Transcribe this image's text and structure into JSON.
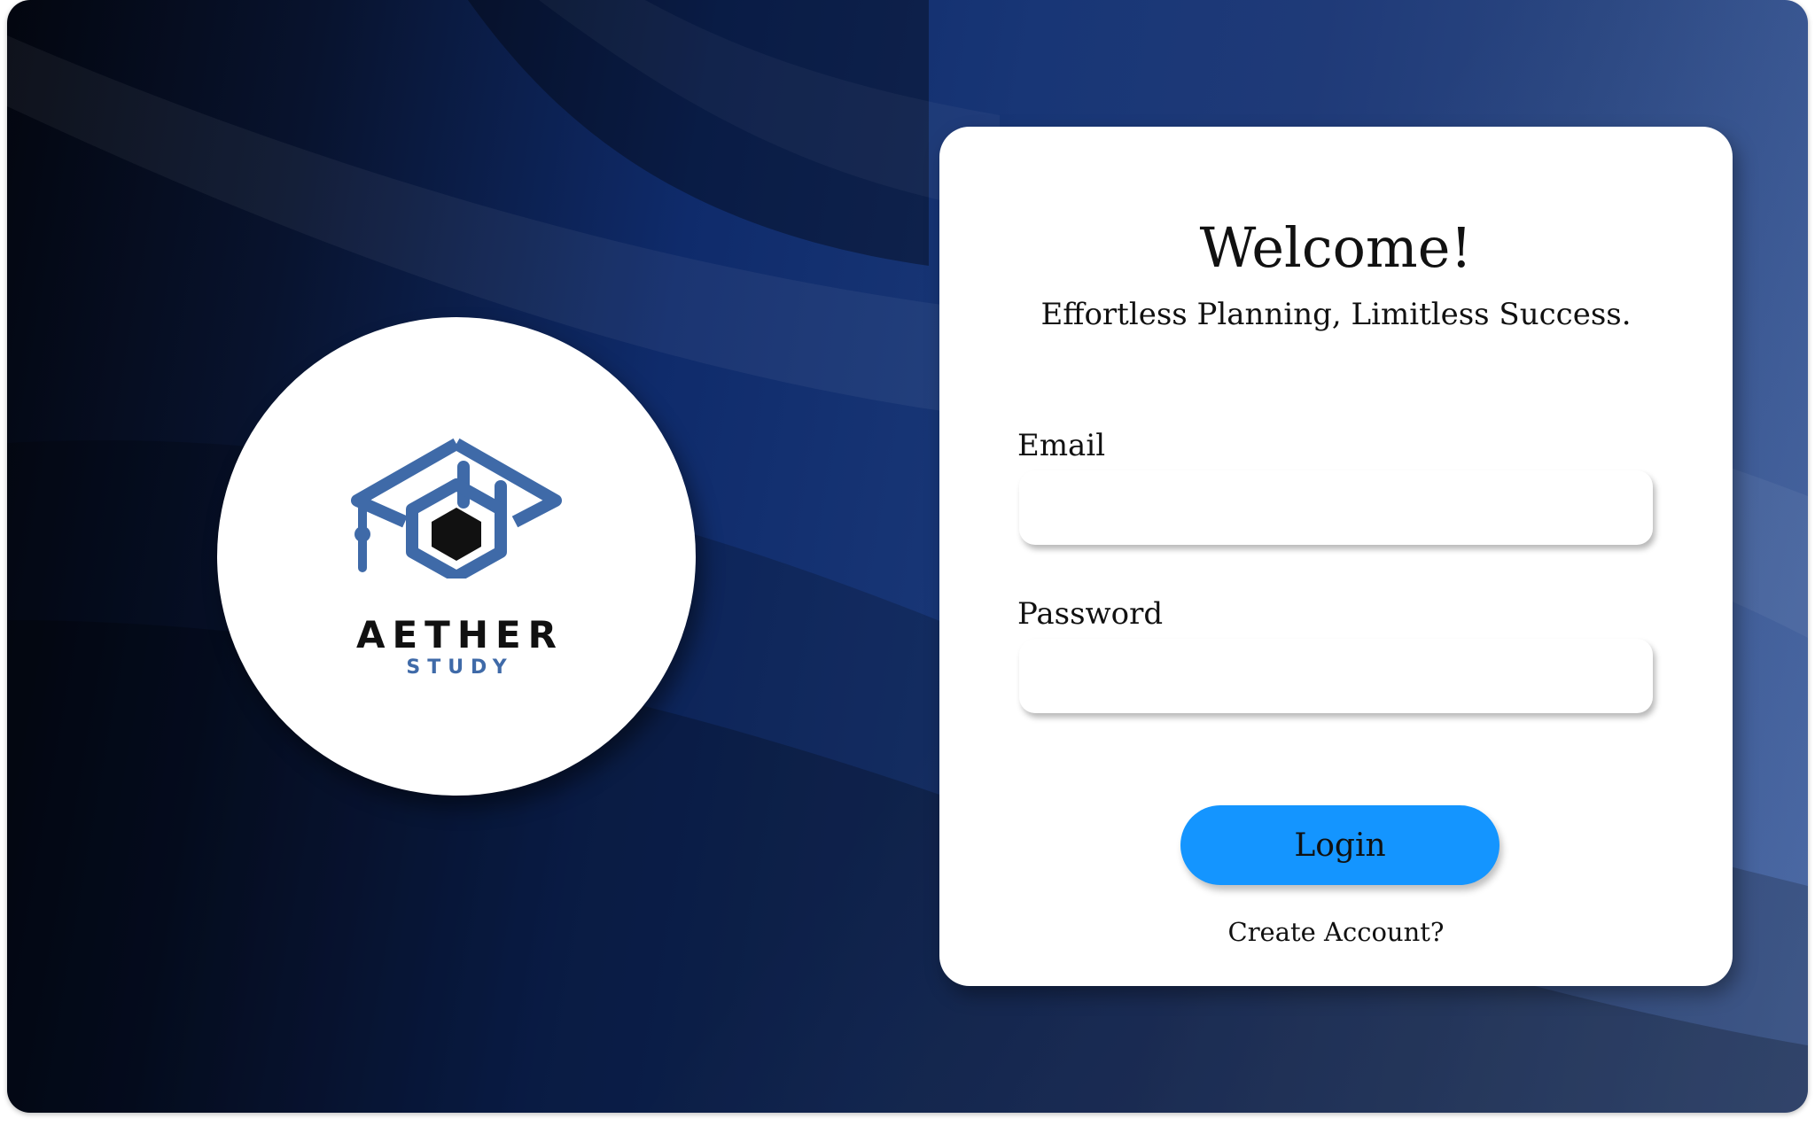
{
  "brand": {
    "name": "AETHER",
    "subname": "STUDY",
    "logo_icon": "graduation-cap-hexagon-icon",
    "colors": {
      "logo_blue": "#3f6aa8",
      "logo_dark": "#111111"
    }
  },
  "login": {
    "title": "Welcome!",
    "tagline": "Effortless Planning, Limitless Success.",
    "email_label": "Email",
    "email_value": "",
    "password_label": "Password",
    "password_value": "",
    "login_button": "Login",
    "create_account_link": "Create Account?"
  },
  "theme": {
    "accent": "#1495ff",
    "card_background": "#ffffff",
    "background_dark": "#03060f",
    "background_blue": "#1f3a78"
  }
}
